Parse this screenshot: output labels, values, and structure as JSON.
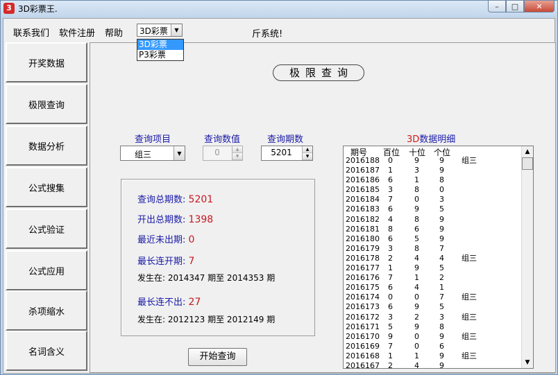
{
  "window": {
    "title": "3D彩票王."
  },
  "menu": {
    "items": [
      "联系我们",
      "软件注册",
      "帮助"
    ],
    "lottery_select": {
      "value": "3D彩票",
      "options": [
        "3D彩票",
        "P3彩票"
      ]
    },
    "system_text": "斤系统!"
  },
  "sidebar": {
    "items": [
      "开奖数据",
      "极限查询",
      "数据分析",
      "公式搜集",
      "公式验证",
      "公式应用",
      "杀项缩水",
      "名词含义"
    ]
  },
  "main": {
    "title": "极限查询",
    "query_item": {
      "label": "查询项目",
      "value": "组三"
    },
    "query_value": {
      "label": "查询数值",
      "value": "0"
    },
    "query_periods": {
      "label": "查询期数",
      "value": "5201"
    },
    "start_button": "开始查询"
  },
  "stats": {
    "total_periods": {
      "label": "查询总期数:",
      "value": "5201"
    },
    "total_hits": {
      "label": "开出总期数:",
      "value": "1398"
    },
    "recent_miss": {
      "label": "最近未出期:",
      "value": "0"
    },
    "longest_streak": {
      "label": "最长连开期:",
      "value": "7"
    },
    "streak_occurred": "发生在: 2014347 期至 2014353 期",
    "longest_gap": {
      "label": "最长连不出:",
      "value": "27"
    },
    "gap_occurred": "发生在: 2012123 期至 2012149 期"
  },
  "detail": {
    "title_red": "3D",
    "title_rest": "数据明细",
    "columns": [
      "期号",
      "百位",
      "十位",
      "个位"
    ],
    "rows": [
      [
        "2016188",
        "0",
        "9",
        "9",
        "组三"
      ],
      [
        "2016187",
        "1",
        "3",
        "9",
        ""
      ],
      [
        "2016186",
        "6",
        "1",
        "8",
        ""
      ],
      [
        "2016185",
        "3",
        "8",
        "0",
        ""
      ],
      [
        "2016184",
        "7",
        "0",
        "3",
        ""
      ],
      [
        "2016183",
        "6",
        "9",
        "5",
        ""
      ],
      [
        "2016182",
        "4",
        "8",
        "9",
        ""
      ],
      [
        "2016181",
        "8",
        "6",
        "9",
        ""
      ],
      [
        "2016180",
        "6",
        "5",
        "9",
        ""
      ],
      [
        "2016179",
        "3",
        "8",
        "7",
        ""
      ],
      [
        "2016178",
        "2",
        "4",
        "4",
        "组三"
      ],
      [
        "2016177",
        "1",
        "9",
        "5",
        ""
      ],
      [
        "2016176",
        "7",
        "1",
        "2",
        ""
      ],
      [
        "2016175",
        "6",
        "4",
        "1",
        ""
      ],
      [
        "2016174",
        "0",
        "0",
        "7",
        "组三"
      ],
      [
        "2016173",
        "6",
        "9",
        "5",
        ""
      ],
      [
        "2016172",
        "3",
        "2",
        "3",
        "组三"
      ],
      [
        "2016171",
        "5",
        "9",
        "8",
        ""
      ],
      [
        "2016170",
        "9",
        "0",
        "9",
        "组三"
      ],
      [
        "2016169",
        "7",
        "0",
        "6",
        ""
      ],
      [
        "2016168",
        "1",
        "1",
        "9",
        "组三"
      ],
      [
        "2016167",
        "2",
        "4",
        "9",
        ""
      ]
    ]
  }
}
